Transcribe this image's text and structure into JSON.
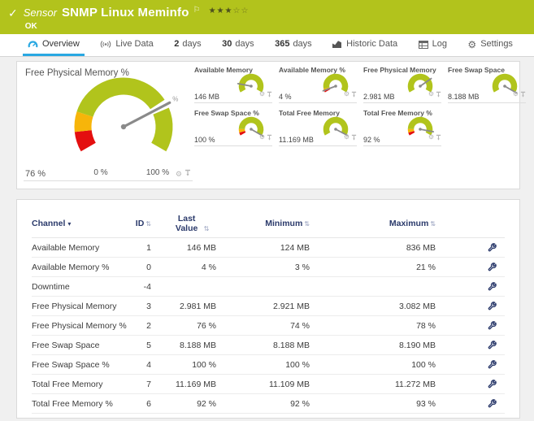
{
  "header": {
    "type_label": "Sensor",
    "title": "SNMP Linux Meminfo",
    "status": "OK",
    "stars_filled": "★★★",
    "stars_empty": "☆☆"
  },
  "icons": {
    "check": "✓",
    "flag": "⚐",
    "gear": "⚙",
    "sort": "⇅",
    "caret_down": "▾"
  },
  "colors": {
    "brand_green": "#b2c31c",
    "accent_blue": "#29a8e2",
    "gauge_green": "#b1c41c",
    "gauge_yellow": "#f7b50a",
    "gauge_red": "#e40f0f",
    "table_header_navy": "#2b3a6b"
  },
  "tabs": [
    {
      "label": "Overview",
      "icon": "gauge",
      "active": true
    },
    {
      "label": "Live Data",
      "icon": "signal"
    },
    {
      "num": "2",
      "label": "days"
    },
    {
      "num": "30",
      "label": "days"
    },
    {
      "num": "365",
      "label": "days"
    },
    {
      "label": "Historic Data",
      "icon": "chart"
    },
    {
      "label": "Log",
      "icon": "log"
    },
    {
      "label": "Settings",
      "icon": "gear"
    }
  ],
  "chart_data": {
    "type": "gauge-dashboard",
    "main_gauge": {
      "title": "Free Physical Memory %",
      "value": 76,
      "unit": "%",
      "min": 0,
      "max": 100,
      "value_label": "76 %",
      "min_label": "0 %",
      "max_label": "100 %",
      "segments": [
        {
          "from": 0,
          "to": 10,
          "color": "#e40f0f"
        },
        {
          "from": 10,
          "to": 20,
          "color": "#f7b50a"
        },
        {
          "from": 20,
          "to": 100,
          "color": "#b1c41c"
        }
      ]
    },
    "small_gauges": [
      {
        "title": "Available Memory",
        "value_label": "146 MB",
        "fraction": 0.17,
        "segments": [
          {
            "from": 0,
            "to": 1,
            "color": "#b1c41c"
          }
        ]
      },
      {
        "title": "Available Memory %",
        "value_label": "4 %",
        "fraction": 0.04,
        "segments": [
          {
            "from": 0,
            "to": 0.04,
            "color": "#e40f0f"
          },
          {
            "from": 0.04,
            "to": 0.08,
            "color": "#f7b50a"
          },
          {
            "from": 0.08,
            "to": 1,
            "color": "#b1c41c"
          }
        ]
      },
      {
        "title": "Free Physical Memory",
        "value_label": "2.981 MB",
        "fraction": 0.73,
        "segments": [
          {
            "from": 0,
            "to": 1,
            "color": "#b1c41c"
          }
        ]
      },
      {
        "title": "Free Swap Space",
        "value_label": "8.188 MB",
        "fraction": 1,
        "segments": [
          {
            "from": 0,
            "to": 1,
            "color": "#b1c41c"
          }
        ]
      },
      {
        "title": "Free Swap Space %",
        "value_label": "100 %",
        "fraction": 1,
        "segments": [
          {
            "from": 0,
            "to": 0.06,
            "color": "#e40f0f"
          },
          {
            "from": 0.06,
            "to": 0.13,
            "color": "#f7b50a"
          },
          {
            "from": 0.13,
            "to": 1,
            "color": "#b1c41c"
          }
        ]
      },
      {
        "title": "Total Free Memory",
        "value_label": "11.169 MB",
        "fraction": 0.99,
        "segments": [
          {
            "from": 0,
            "to": 1,
            "color": "#b1c41c"
          }
        ]
      },
      {
        "title": "Total Free Memory %",
        "value_label": "92 %",
        "fraction": 0.92,
        "segments": [
          {
            "from": 0,
            "to": 0.06,
            "color": "#e40f0f"
          },
          {
            "from": 0.06,
            "to": 0.13,
            "color": "#f7b50a"
          },
          {
            "from": 0.13,
            "to": 1,
            "color": "#b1c41c"
          }
        ]
      }
    ]
  },
  "table": {
    "columns": [
      "Channel",
      "ID",
      "Last Value",
      "Minimum",
      "Maximum"
    ],
    "rows": [
      {
        "channel": "Available Memory",
        "id": "1",
        "last": "146 MB",
        "min": "124 MB",
        "max": "836 MB"
      },
      {
        "channel": "Available Memory %",
        "id": "0",
        "last": "4 %",
        "min": "3 %",
        "max": "21 %"
      },
      {
        "channel": "Downtime",
        "id": "-4",
        "last": "",
        "min": "",
        "max": ""
      },
      {
        "channel": "Free Physical Memory",
        "id": "3",
        "last": "2.981 MB",
        "min": "2.921 MB",
        "max": "3.082 MB"
      },
      {
        "channel": "Free Physical Memory %",
        "id": "2",
        "last": "76 %",
        "min": "74 %",
        "max": "78 %"
      },
      {
        "channel": "Free Swap Space",
        "id": "5",
        "last": "8.188 MB",
        "min": "8.188 MB",
        "max": "8.190 MB"
      },
      {
        "channel": "Free Swap Space %",
        "id": "4",
        "last": "100 %",
        "min": "100 %",
        "max": "100 %"
      },
      {
        "channel": "Total Free Memory",
        "id": "7",
        "last": "11.169 MB",
        "min": "11.109 MB",
        "max": "11.272 MB"
      },
      {
        "channel": "Total Free Memory %",
        "id": "6",
        "last": "92 %",
        "min": "92 %",
        "max": "93 %"
      }
    ]
  }
}
